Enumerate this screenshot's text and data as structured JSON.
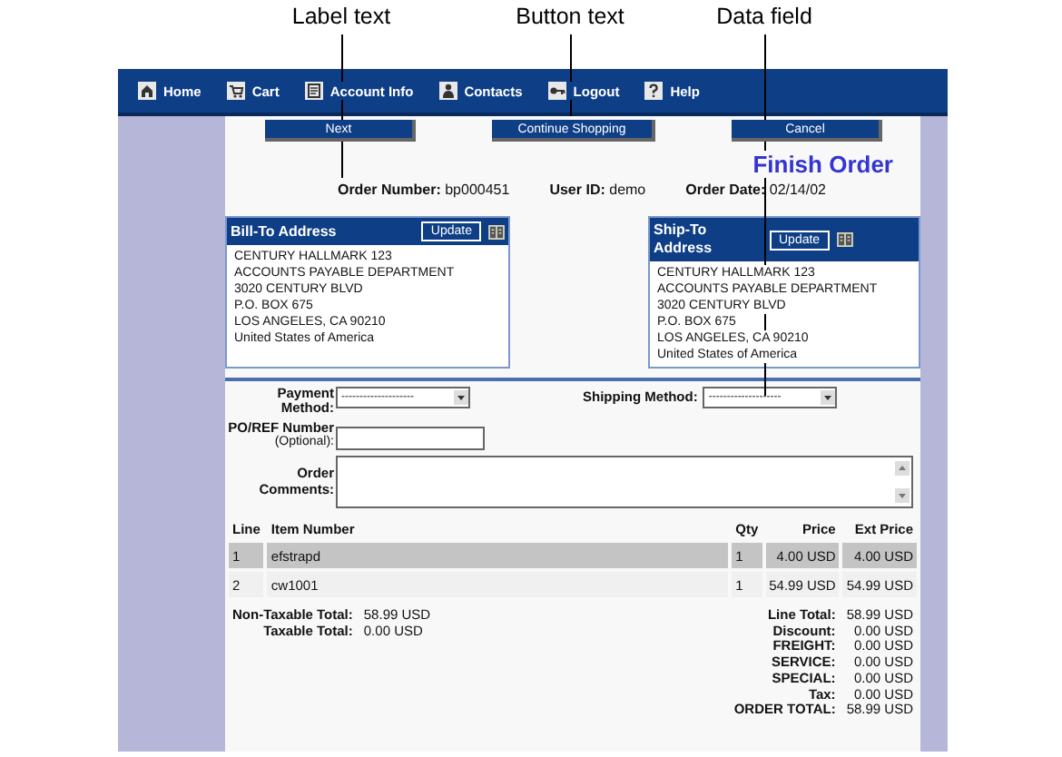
{
  "annotations": [
    {
      "text": "Label text"
    },
    {
      "text": "Button text"
    },
    {
      "text": "Data field"
    }
  ],
  "nav": [
    {
      "kind": "home",
      "label": "Home"
    },
    {
      "kind": "cart",
      "label": "Cart"
    },
    {
      "kind": "account",
      "label": "Account Info"
    },
    {
      "kind": "contacts",
      "label": "Contacts"
    },
    {
      "kind": "logout",
      "label": "Logout"
    },
    {
      "kind": "help",
      "label": "Help"
    }
  ],
  "buttons": [
    "Next",
    "Continue Shopping",
    "Cancel"
  ],
  "title": "Finish Order",
  "order_info": [
    {
      "label": "Order Number:",
      "value": "bp000451"
    },
    {
      "label": "User ID:",
      "value": "demo"
    },
    {
      "label": "Order Date:",
      "value": "02/14/02"
    }
  ],
  "addresses": [
    {
      "title": "Bill-To Address",
      "button": "Update",
      "lines": [
        "CENTURY HALLMARK 123",
        "ACCOUNTS PAYABLE DEPARTMENT",
        "3020 CENTURY BLVD",
        "P.O. BOX 675",
        "LOS ANGELES, CA 90210",
        "United States of America"
      ]
    },
    {
      "title": "Ship-To Address",
      "button": "Update",
      "lines": [
        "CENTURY HALLMARK 123",
        "ACCOUNTS PAYABLE DEPARTMENT",
        "3020 CENTURY BLVD",
        "P.O. BOX 675",
        "LOS ANGELES, CA 90210",
        "United States of America"
      ]
    }
  ],
  "form": {
    "payment_method": {
      "label": "Payment Method:",
      "value": "--------------------"
    },
    "shipping_method": {
      "label": "Shipping Method:",
      "value": "--------------------"
    },
    "po_ref": {
      "label": "PO/REF Number",
      "hint": "(Optional):"
    },
    "comments": {
      "label": "Order Comments:"
    }
  },
  "table": {
    "columns": [
      "Line",
      "Item Number",
      "Qty",
      "Price",
      "Ext Price"
    ],
    "rows": [
      {
        "selected": true,
        "cells": [
          "1",
          "efstrapd",
          "1",
          "4.00 USD",
          "4.00 USD"
        ]
      },
      {
        "selected": false,
        "cells": [
          "2",
          "cw1001",
          "1",
          "54.99 USD",
          "54.99 USD"
        ]
      }
    ]
  },
  "totals_left": [
    {
      "label": "Non-Taxable Total:",
      "value": "58.99 USD"
    },
    {
      "label": "Taxable Total:",
      "value": "0.00 USD"
    }
  ],
  "totals_right": [
    {
      "label": "Line Total:",
      "value": "58.99 USD"
    },
    {
      "label": "Discount:",
      "value": "0.00 USD"
    },
    {
      "label": "FREIGHT:",
      "value": "0.00 USD"
    },
    {
      "label": "SERVICE:",
      "value": "0.00 USD"
    },
    {
      "label": "SPECIAL:",
      "value": "0.00 USD"
    },
    {
      "label": "Tax:",
      "value": "0.00 USD"
    },
    {
      "label": "ORDER TOTAL:",
      "value": "58.99 USD"
    }
  ]
}
